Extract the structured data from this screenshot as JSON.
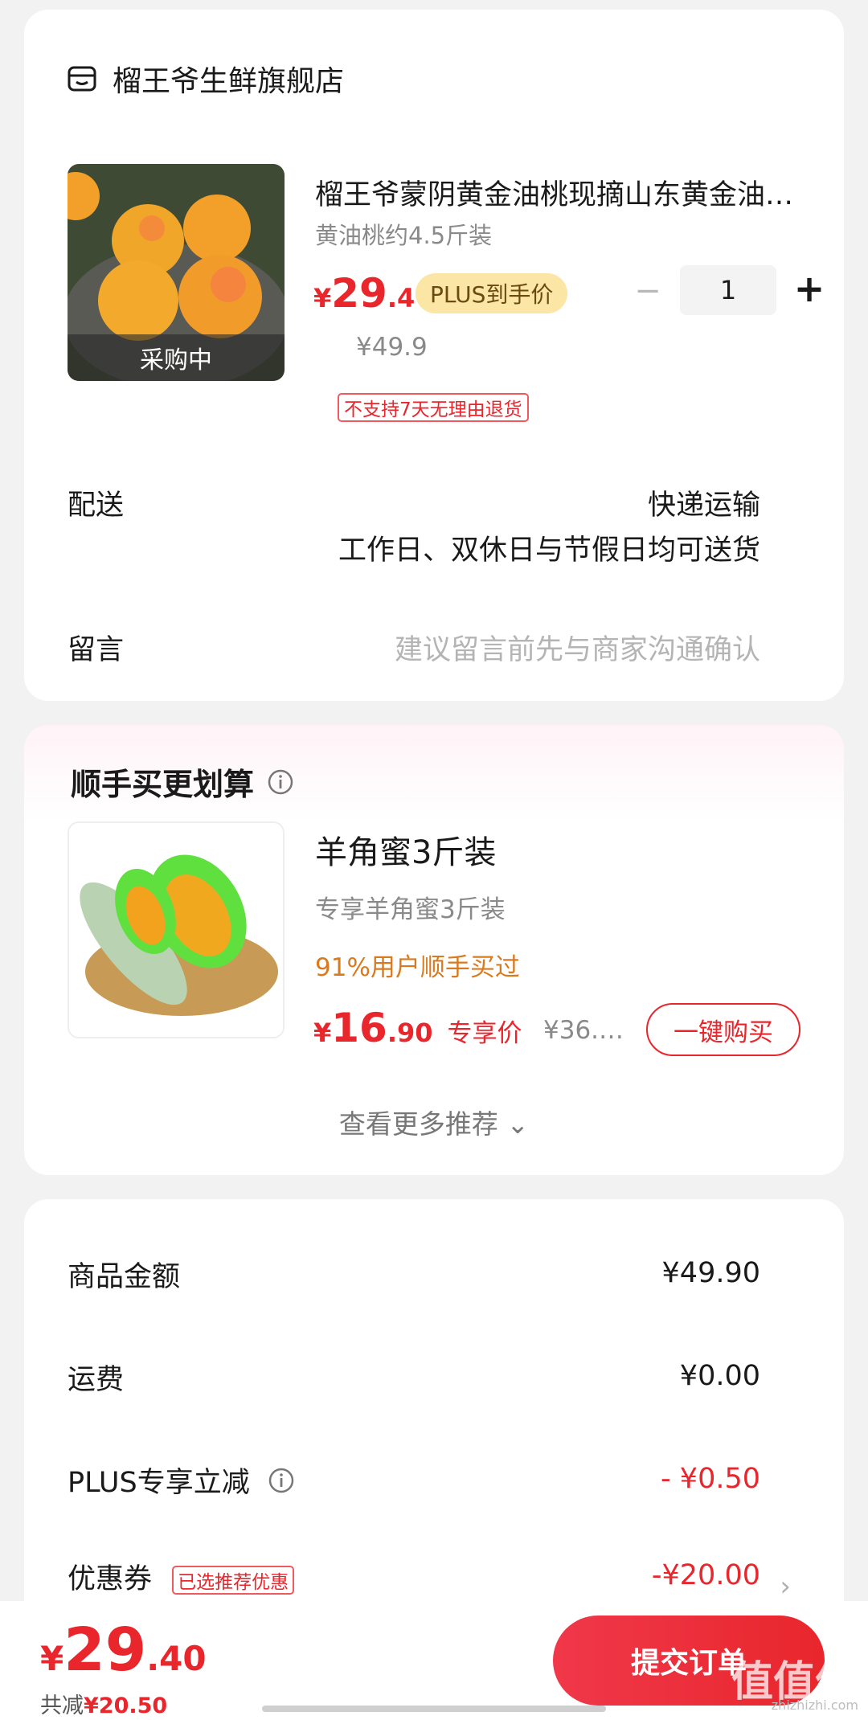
{
  "shop": {
    "name": "榴王爷生鲜旗舰店",
    "icon": "shop-icon"
  },
  "product": {
    "title": "榴王爷蒙阴黄金油桃现摘山东黄金油桃当季新鲜水果",
    "spec": "黄油桃约4.5斤装",
    "image_badge": "采购中",
    "currency": "¥",
    "price_int": "29",
    "price_dec": ".4",
    "plus_badge": "PLUS到手价",
    "original_price": "¥49.9",
    "quantity": "1",
    "minus_symbol": "−",
    "plus_symbol": "+",
    "return_tag": "不支持7天无理由退货"
  },
  "delivery": {
    "label": "配送",
    "method": "快递运输",
    "note": "工作日、双休日与节假日均可送货"
  },
  "message": {
    "label": "留言",
    "placeholder": "建议留言前先与商家沟通确认"
  },
  "recommend": {
    "title": "顺手买更划算",
    "name": "羊角蜜3斤装",
    "desc": "专享羊角蜜3斤装",
    "stat": "91%用户顺手买过",
    "currency": "¥",
    "price_int": "16",
    "price_dec": ".90",
    "price_label": "专享价",
    "original_price": "¥36.…",
    "buy_button": "一键购买",
    "more": "查看更多推荐 ⌄"
  },
  "summary": {
    "items": [
      {
        "label": "商品金额",
        "value": "¥49.90"
      },
      {
        "label": "运费",
        "value": "¥0.00"
      },
      {
        "label": "PLUS专享立减",
        "value": "- ¥0.50"
      },
      {
        "label": "优惠券",
        "value": "-¥20.00"
      }
    ],
    "coupon_tag": "已选推荐优惠"
  },
  "bottom": {
    "currency": "¥",
    "total_int": "29",
    "total_dec": ".40",
    "saved_label": "共减",
    "saved_value": "¥20.50",
    "submit": "提交订单",
    "watermark": "值值值",
    "watermark_url": "zhizhizhi.com"
  },
  "colors": {
    "accent": "#e8262c",
    "plus_badge_bg": "#fbe6a6",
    "stat_orange": "#d97a1f"
  }
}
